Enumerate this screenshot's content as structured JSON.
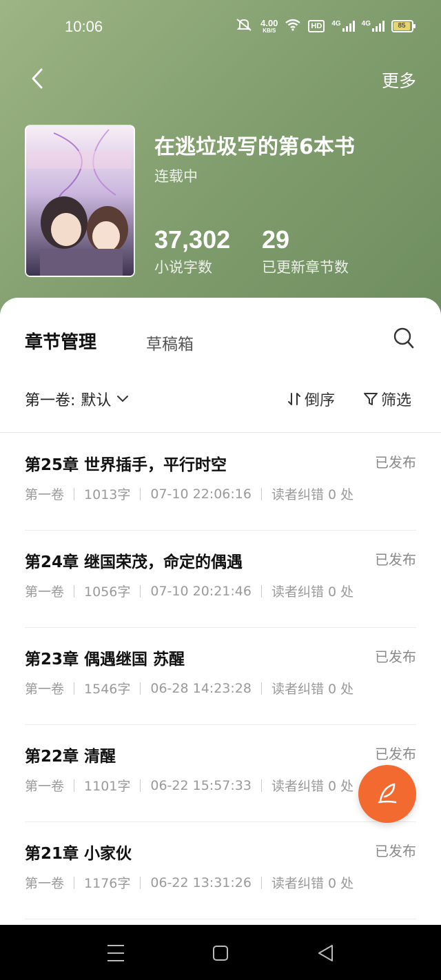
{
  "statusbar": {
    "time": "10:06",
    "net_speed_value": "4.00",
    "net_speed_unit": "KB/S",
    "hd_label": "HD",
    "signal1_label": "4G",
    "signal2_label": "4G",
    "battery_level": "85"
  },
  "header": {
    "more_label": "更多"
  },
  "book": {
    "title": "在逃垃圾写的第6本书",
    "status": "连载中",
    "word_count": "37,302",
    "word_count_label": "小说字数",
    "chapter_count": "29",
    "chapter_count_label": "已更新章节数"
  },
  "tabs": {
    "active": "章节管理",
    "drafts": "草稿箱"
  },
  "toolbar": {
    "volume_prefix": "第一卷:",
    "volume_value": "默认",
    "sort_label": "倒序",
    "filter_label": "筛选"
  },
  "chapters": [
    {
      "title": "第25章 世界插手，平行时空",
      "status": "已发布",
      "volume": "第一卷",
      "words": "1013字",
      "time": "07-10 22:06:16",
      "errors": "读者纠错 0 处"
    },
    {
      "title": "第24章 继国荣茂，命定的偶遇",
      "status": "已发布",
      "volume": "第一卷",
      "words": "1056字",
      "time": "07-10 20:21:46",
      "errors": "读者纠错 0 处"
    },
    {
      "title": "第23章 偶遇继国 苏醒",
      "status": "已发布",
      "volume": "第一卷",
      "words": "1546字",
      "time": "06-28 14:23:28",
      "errors": "读者纠错 0 处"
    },
    {
      "title": "第22章 清醒",
      "status": "已发布",
      "volume": "第一卷",
      "words": "1101字",
      "time": "06-22 15:57:33",
      "errors": "读者纠错 0 处"
    },
    {
      "title": "第21章 小家伙",
      "status": "已发布",
      "volume": "第一卷",
      "words": "1176字",
      "time": "06-22 13:31:26",
      "errors": "读者纠错 0 处"
    }
  ],
  "icons": {
    "back": "back-chevron-icon",
    "search": "search-icon",
    "sort": "sort-arrows-icon",
    "filter": "filter-funnel-icon",
    "fab": "quill-pen-icon"
  },
  "colors": {
    "hero_green": "#7f9c6c",
    "fab_orange": "#f26a2f"
  }
}
